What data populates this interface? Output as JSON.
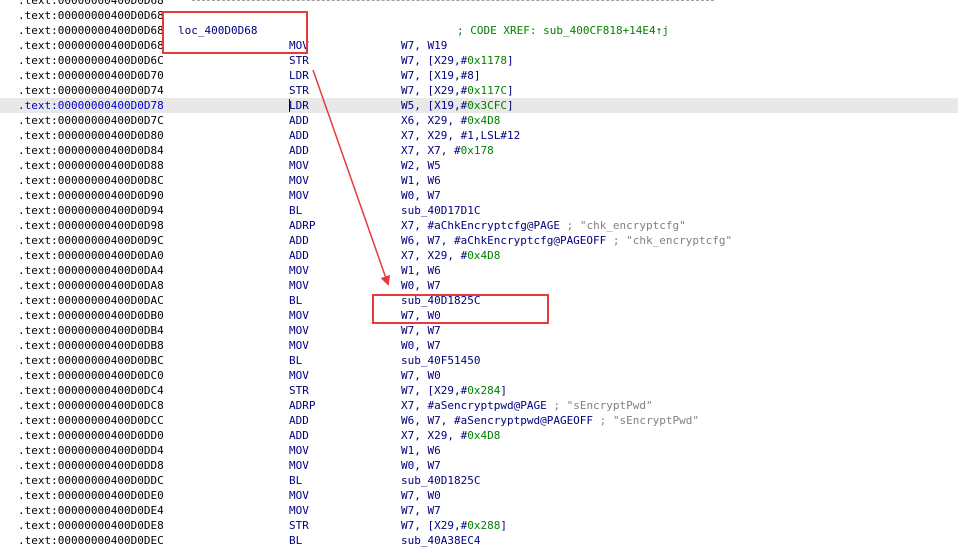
{
  "annotation_color": "#e83a3a",
  "rows": [
    {
      "addr": ".text:00000000400D0D68",
      "separator": true
    },
    {
      "addr": ".text:00000000400D0D68"
    },
    {
      "addr": ".text:00000000400D0D68",
      "label": "loc_400D0D68",
      "xref": "; CODE XREF: sub_400CF818+14E4↑j"
    },
    {
      "addr": ".text:00000000400D0D68",
      "mnem": "MOV",
      "ops": "W7, W19"
    },
    {
      "addr": ".text:00000000400D0D6C",
      "mnem": "STR",
      "ops": "W7, [X29,#",
      "num": "0x1178",
      "tail": "]"
    },
    {
      "addr": ".text:00000000400D0D70",
      "mnem": "LDR",
      "ops": "W7, [X19,#8]"
    },
    {
      "addr": ".text:00000000400D0D74",
      "mnem": "STR",
      "ops": "W7, [X29,#",
      "num": "0x117C",
      "tail": "]"
    },
    {
      "addr": ".text:00000000400D0D78",
      "mnem": "LDR",
      "ops": "W5, [X19,#",
      "num": "0x3CFC",
      "tail": "]",
      "highlight": true
    },
    {
      "addr": ".text:00000000400D0D7C",
      "mnem": "ADD",
      "ops": "X6, X29, #",
      "num": "0x4D8"
    },
    {
      "addr": ".text:00000000400D0D80",
      "mnem": "ADD",
      "ops": "X7, X29, #1,LSL#12"
    },
    {
      "addr": ".text:00000000400D0D84",
      "mnem": "ADD",
      "ops": "X7, X7, #",
      "num": "0x178"
    },
    {
      "addr": ".text:00000000400D0D88",
      "mnem": "MOV",
      "ops": "W2, W5"
    },
    {
      "addr": ".text:00000000400D0D8C",
      "mnem": "MOV",
      "ops": "W1, W6"
    },
    {
      "addr": ".text:00000000400D0D90",
      "mnem": "MOV",
      "ops": "W0, W7"
    },
    {
      "addr": ".text:00000000400D0D94",
      "mnem": "BL",
      "ops": "sub_40D17D1C"
    },
    {
      "addr": ".text:00000000400D0D98",
      "mnem": "ADRP",
      "ops": "X7, #aChkEncryptcfg@PAGE",
      "comment": " ; \"chk_encryptcfg\""
    },
    {
      "addr": ".text:00000000400D0D9C",
      "mnem": "ADD",
      "ops": "W6, W7, #aChkEncryptcfg@PAGEOFF",
      "comment": " ; \"chk_encryptcfg\""
    },
    {
      "addr": ".text:00000000400D0DA0",
      "mnem": "ADD",
      "ops": "X7, X29, #",
      "num": "0x4D8"
    },
    {
      "addr": ".text:00000000400D0DA4",
      "mnem": "MOV",
      "ops": "W1, W6"
    },
    {
      "addr": ".text:00000000400D0DA8",
      "mnem": "MOV",
      "ops": "W0, W7"
    },
    {
      "addr": ".text:00000000400D0DAC",
      "mnem": "BL",
      "ops": "sub_40D1825C"
    },
    {
      "addr": ".text:00000000400D0DB0",
      "mnem": "MOV",
      "ops": "W7, W0"
    },
    {
      "addr": ".text:00000000400D0DB4",
      "mnem": "MOV",
      "ops": "W7, W7"
    },
    {
      "addr": ".text:00000000400D0DB8",
      "mnem": "MOV",
      "ops": "W0, W7"
    },
    {
      "addr": ".text:00000000400D0DBC",
      "mnem": "BL",
      "ops": "sub_40F51450"
    },
    {
      "addr": ".text:00000000400D0DC0",
      "mnem": "MOV",
      "ops": "W7, W0"
    },
    {
      "addr": ".text:00000000400D0DC4",
      "mnem": "STR",
      "ops": "W7, [X29,#",
      "num": "0x284",
      "tail": "]"
    },
    {
      "addr": ".text:00000000400D0DC8",
      "mnem": "ADRP",
      "ops": "X7, #aSencryptpwd@PAGE",
      "comment": " ; \"sEncryptPwd\""
    },
    {
      "addr": ".text:00000000400D0DCC",
      "mnem": "ADD",
      "ops": "W6, W7, #aSencryptpwd@PAGEOFF",
      "comment": " ; \"sEncryptPwd\""
    },
    {
      "addr": ".text:00000000400D0DD0",
      "mnem": "ADD",
      "ops": "X7, X29, #",
      "num": "0x4D8"
    },
    {
      "addr": ".text:00000000400D0DD4",
      "mnem": "MOV",
      "ops": "W1, W6"
    },
    {
      "addr": ".text:00000000400D0DD8",
      "mnem": "MOV",
      "ops": "W0, W7"
    },
    {
      "addr": ".text:00000000400D0DDC",
      "mnem": "BL",
      "ops": "sub_40D1825C"
    },
    {
      "addr": ".text:00000000400D0DE0",
      "mnem": "MOV",
      "ops": "W7, W0"
    },
    {
      "addr": ".text:00000000400D0DE4",
      "mnem": "MOV",
      "ops": "W7, W7"
    },
    {
      "addr": ".text:00000000400D0DE8",
      "mnem": "STR",
      "ops": "W7, [X29,#",
      "num": "0x288",
      "tail": "]"
    },
    {
      "addr": ".text:00000000400D0DEC",
      "mnem": "BL",
      "ops": "sub_40A38EC4"
    }
  ]
}
